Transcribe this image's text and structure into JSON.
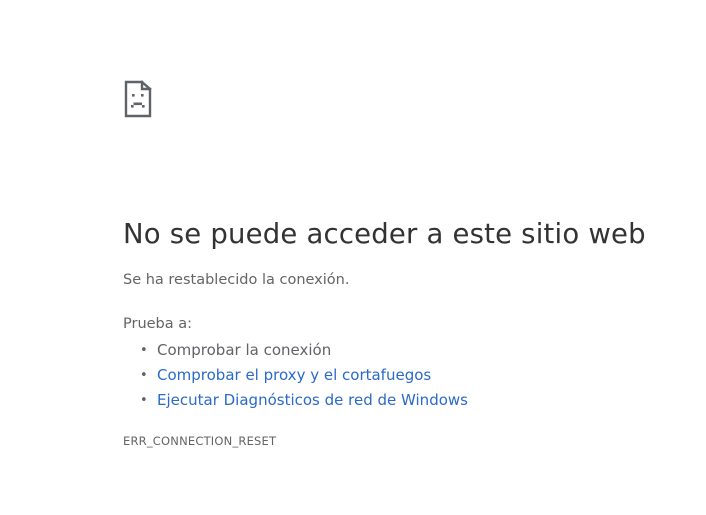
{
  "error_page": {
    "icon": "sad-page-icon",
    "title": "No se puede acceder a este sitio web",
    "message": "Se ha restablecido la conexión.",
    "try_label": "Prueba a:",
    "suggestions": [
      {
        "label": "Comprobar la conexión",
        "link": false
      },
      {
        "label": "Comprobar el proxy y el cortafuegos",
        "link": true
      },
      {
        "label": "Ejecutar Diagnósticos de red de Windows",
        "link": true
      }
    ],
    "error_code": "ERR_CONNECTION_RESET"
  },
  "colors": {
    "heading": "#333333",
    "text": "#646464",
    "link": "#2a6ac8",
    "icon": "#5f6368"
  }
}
